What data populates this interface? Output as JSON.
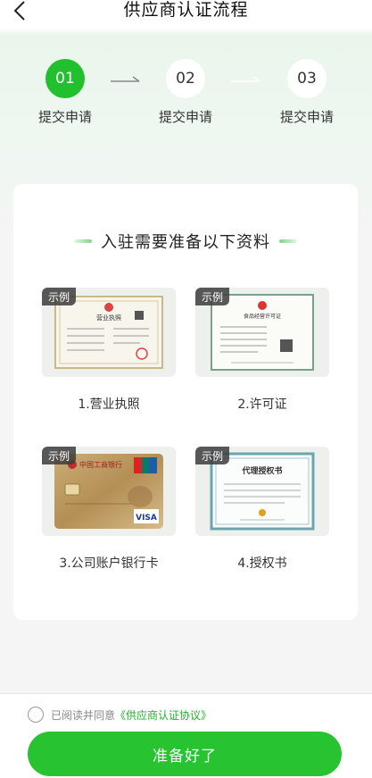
{
  "header": {
    "title": "供应商认证流程",
    "back_icon": "chevron-left-icon"
  },
  "steps": [
    {
      "number": "01",
      "label": "提交申请",
      "active": true
    },
    {
      "number": "02",
      "label": "提交申请",
      "active": false
    },
    {
      "number": "03",
      "label": "提交申请",
      "active": false
    }
  ],
  "card": {
    "title": "入驻需要准备以下资料",
    "sample_tag": "示例",
    "documents": [
      {
        "label": "1.营业执照",
        "thumb_heading": "营业执照"
      },
      {
        "label": "2.许可证",
        "thumb_heading": "食品经营许可证"
      },
      {
        "label": "3.公司账户银行卡",
        "thumb_heading": "中国工商银行",
        "card_brand": "VISA"
      },
      {
        "label": "4.授权书",
        "thumb_heading": "代理授权书"
      }
    ]
  },
  "footer": {
    "agree_text": "已阅读并同意",
    "agree_link": "《供应商认证协议》",
    "ready_button": "准备好了"
  },
  "colors": {
    "primary": "#27c331",
    "link": "#22b02c"
  }
}
